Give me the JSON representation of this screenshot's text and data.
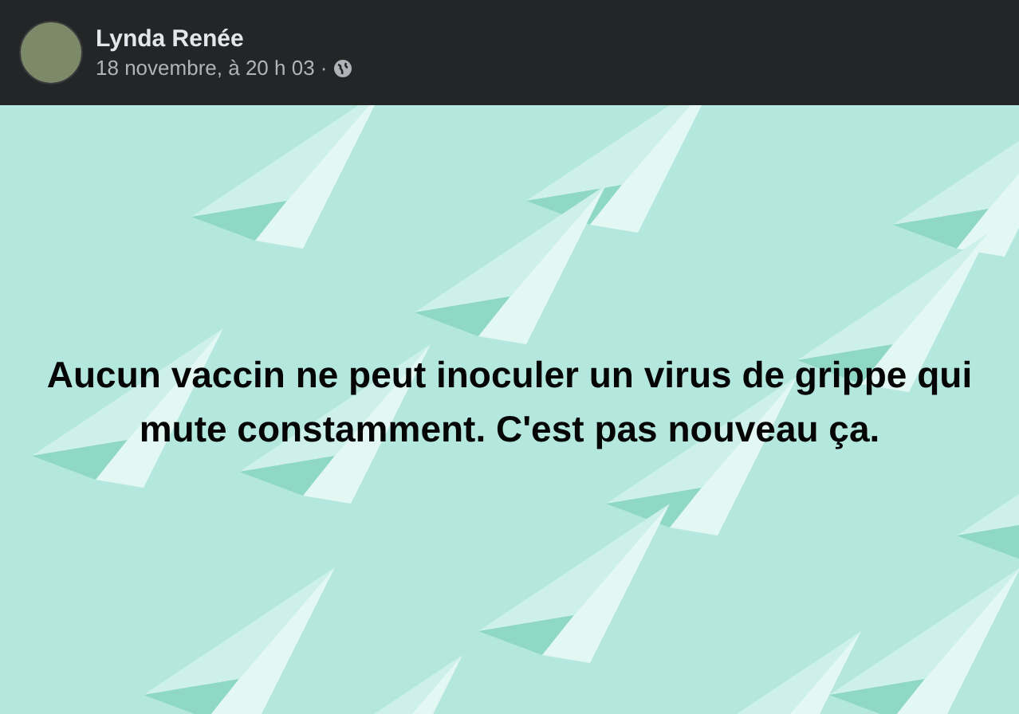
{
  "post": {
    "author": "Lynda Renée",
    "timestamp": "18 novembre, à 20 h 03 ·",
    "text": "Aucun vaccin ne peut inoculer un virus de grippe qui mute constamment. C'est pas nouveau ça."
  }
}
